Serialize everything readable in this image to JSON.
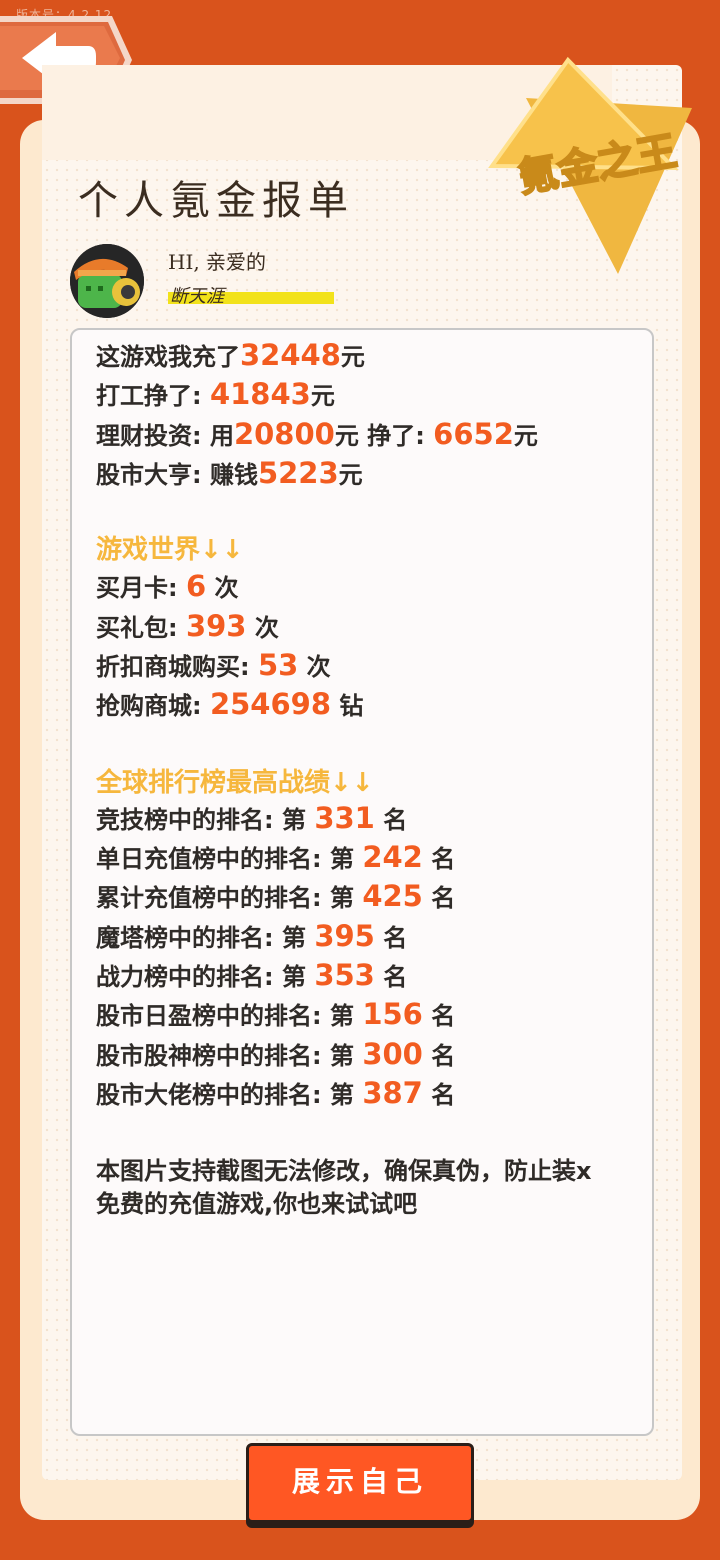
{
  "version": "版本号：4.2.12",
  "header": {
    "title": "个人氪金报单",
    "badge_text": "氪金之王"
  },
  "user": {
    "greeting": "HI, 亲爱的",
    "name": "断天涯"
  },
  "finance": {
    "recharge": {
      "prefix": "这游戏我充了",
      "value": "32448",
      "suffix": "元"
    },
    "work": {
      "prefix": "打工挣了: ",
      "value": "41843",
      "suffix": "元"
    },
    "invest": {
      "prefix": "理财投资: 用",
      "value1": "20800",
      "mid": "元 挣了: ",
      "value2": "6652",
      "suffix": "元"
    },
    "stock": {
      "prefix": "股市大亨: 赚钱",
      "value": "5223",
      "suffix": "元"
    }
  },
  "game_world": {
    "heading": "游戏世界↓↓",
    "items": [
      {
        "prefix": "买月卡: ",
        "value": "6",
        "suffix": " 次"
      },
      {
        "prefix": "买礼包: ",
        "value": "393",
        "suffix": " 次"
      },
      {
        "prefix": "折扣商城购买: ",
        "value": "53",
        "suffix": " 次"
      },
      {
        "prefix": "抢购商城: ",
        "value": "254698",
        "suffix": " 钻"
      }
    ]
  },
  "rankings": {
    "heading": "全球排行榜最高战绩↓↓",
    "items": [
      {
        "prefix": "竞技榜中的排名: 第 ",
        "value": "331",
        "suffix": " 名"
      },
      {
        "prefix": "单日充值榜中的排名: 第 ",
        "value": "242",
        "suffix": " 名"
      },
      {
        "prefix": "累计充值榜中的排名: 第 ",
        "value": "425",
        "suffix": " 名"
      },
      {
        "prefix": "魔塔榜中的排名: 第 ",
        "value": "395",
        "suffix": " 名"
      },
      {
        "prefix": "战力榜中的排名: 第 ",
        "value": "353",
        "suffix": " 名"
      },
      {
        "prefix": "股市日盈榜中的排名: 第 ",
        "value": "156",
        "suffix": " 名"
      },
      {
        "prefix": "股市股神榜中的排名: 第 ",
        "value": "300",
        "suffix": " 名"
      },
      {
        "prefix": "股市大佬榜中的排名: 第 ",
        "value": "387",
        "suffix": " 名"
      }
    ]
  },
  "footer_note": {
    "line1": "本图片支持截图无法修改，确保真伪，防止装x",
    "line2": "免费的充值游戏,你也来试试吧"
  },
  "cta": {
    "label": "展示自己"
  },
  "colors": {
    "accent": "#f25c20",
    "section": "#f6b73d",
    "background": "#d9531c",
    "button": "#ff5723"
  }
}
